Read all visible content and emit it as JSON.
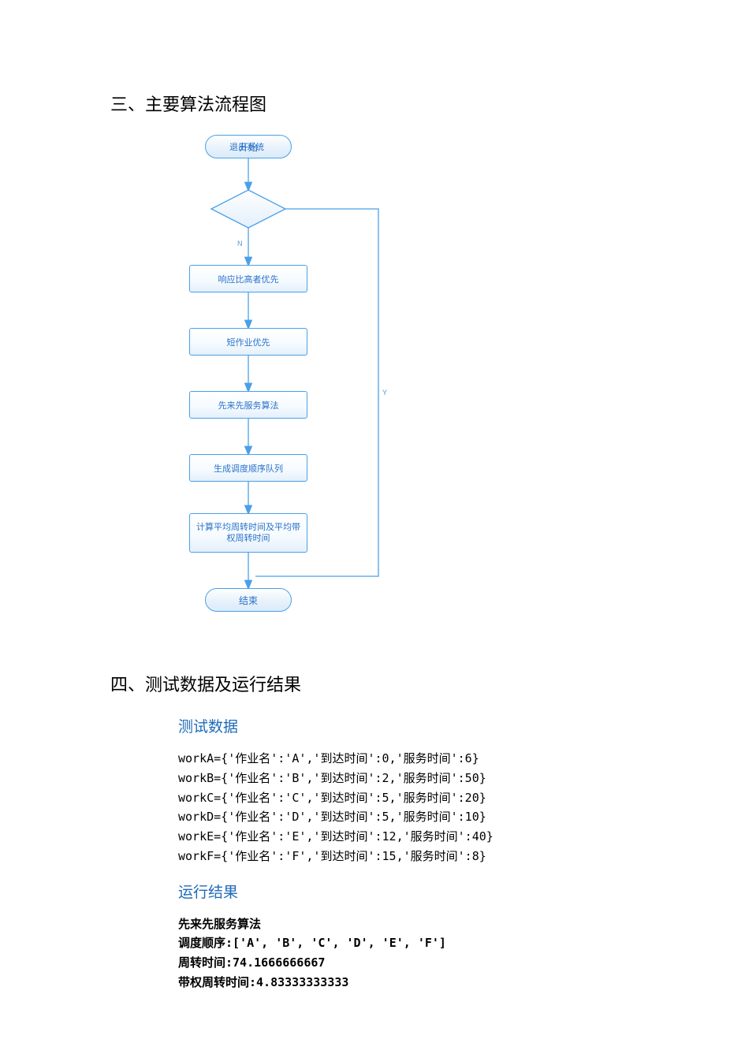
{
  "section3_title": "三、主要算法流程图",
  "section4_title": "四、测试数据及运行结果",
  "flowchart": {
    "start": "开始",
    "decision": "退出系统",
    "decision_no": "N",
    "decision_yes": "Y",
    "step1": "响应比高者优先",
    "step2": "短作业优先",
    "step3": "先来先服务算法",
    "step4": "生成调度顺序队列",
    "step5": "计算平均周转时间及平均带权周转时间",
    "end": "结束"
  },
  "chart_data": {
    "type": "diagram",
    "kind": "flowchart",
    "nodes": [
      {
        "id": "start",
        "type": "terminator",
        "label": "开始"
      },
      {
        "id": "decision",
        "type": "decision",
        "label": "退出系统"
      },
      {
        "id": "s1",
        "type": "process",
        "label": "响应比高者优先"
      },
      {
        "id": "s2",
        "type": "process",
        "label": "短作业优先"
      },
      {
        "id": "s3",
        "type": "process",
        "label": "先来先服务算法"
      },
      {
        "id": "s4",
        "type": "process",
        "label": "生成调度顺序队列"
      },
      {
        "id": "s5",
        "type": "process",
        "label": "计算平均周转时间及平均带权周转时间"
      },
      {
        "id": "end",
        "type": "terminator",
        "label": "结束"
      }
    ],
    "edges": [
      {
        "from": "start",
        "to": "decision",
        "label": ""
      },
      {
        "from": "decision",
        "to": "s1",
        "label": "N"
      },
      {
        "from": "decision",
        "to": "end",
        "label": "Y"
      },
      {
        "from": "s1",
        "to": "s2",
        "label": ""
      },
      {
        "from": "s2",
        "to": "s3",
        "label": ""
      },
      {
        "from": "s3",
        "to": "s4",
        "label": ""
      },
      {
        "from": "s4",
        "to": "s5",
        "label": ""
      },
      {
        "from": "s5",
        "to": "end",
        "label": ""
      }
    ]
  },
  "test_data_heading": "测试数据",
  "test_data_lines": [
    "workA={'作业名':'A','到达时间':0,'服务时间':6}",
    "workB={'作业名':'B','到达时间':2,'服务时间':50}",
    "workC={'作业名':'C','到达时间':5,'服务时间':20}",
    "workD={'作业名':'D','到达时间':5,'服务时间':10}",
    "workE={'作业名':'E','到达时间':12,'服务时间':40}",
    "workF={'作业名':'F','到达时间':15,'服务时间':8}"
  ],
  "result_heading": "运行结果",
  "result_lines": [
    "先来先服务算法",
    "调度顺序:['A', 'B', 'C', 'D', 'E', 'F']",
    "周转时间:74.1666666667",
    "带权周转时间:4.83333333333"
  ]
}
